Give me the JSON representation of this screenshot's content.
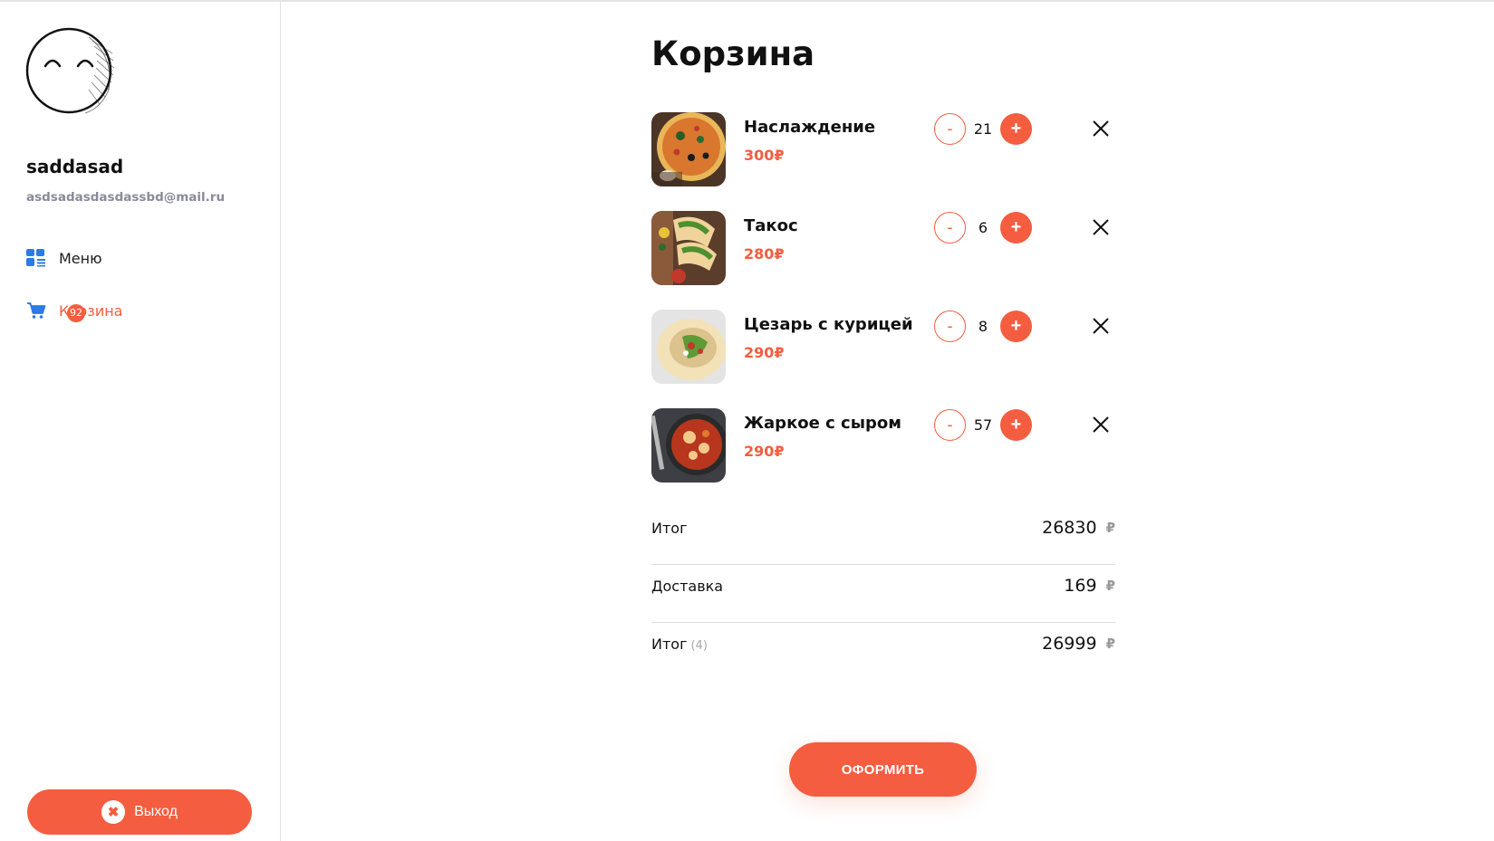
{
  "user": {
    "name": "saddasad",
    "email": "asdsadasdasdassbd@mail.ru"
  },
  "nav": {
    "menu_label": "Меню",
    "cart_label": "Корзина",
    "cart_badge": "92"
  },
  "logout": {
    "label": "Выход"
  },
  "page": {
    "title": "Корзина"
  },
  "cart": {
    "items": [
      {
        "name": "Наслаждение",
        "price": "300₽",
        "quantity": "21",
        "minus": "-",
        "plus": "+"
      },
      {
        "name": "Такос",
        "price": "280₽",
        "quantity": "6",
        "minus": "-",
        "plus": "+"
      },
      {
        "name": "Цезарь с курицей",
        "price": "290₽",
        "quantity": "8",
        "minus": "-",
        "plus": "+"
      },
      {
        "name": "Жаркое с сыром",
        "price": "290₽",
        "quantity": "57",
        "minus": "-",
        "plus": "+"
      }
    ]
  },
  "summary": {
    "subtotal_label": "Итог",
    "subtotal_value": "26830",
    "delivery_label": "Доставка",
    "delivery_value": "169",
    "total_label": "Итог",
    "total_count": "(4)",
    "total_value": "26999",
    "currency": "₽"
  },
  "checkout": {
    "label": "ОФОРМИТЬ"
  },
  "colors": {
    "accent": "#f45d3f",
    "menu_icon": "#2b7be4",
    "muted": "#8a8a99"
  }
}
